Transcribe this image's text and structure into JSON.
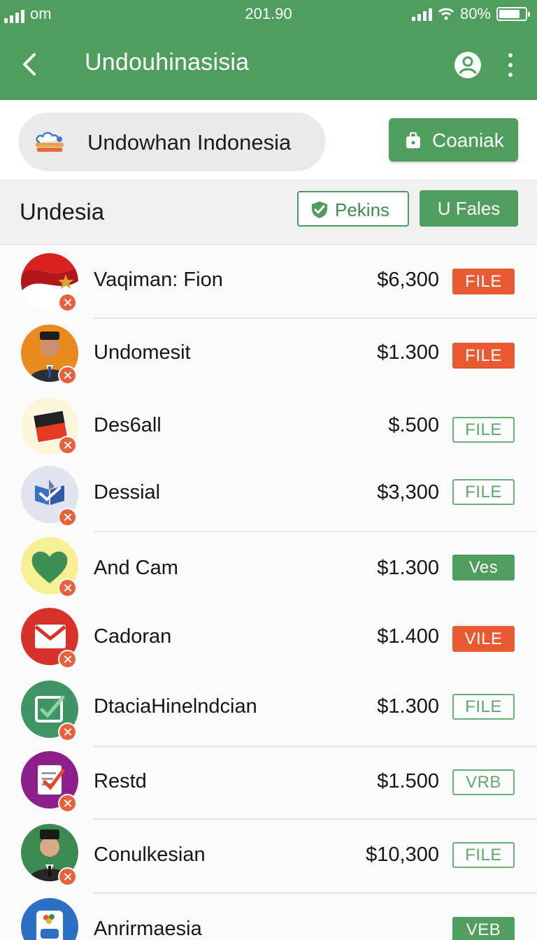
{
  "status": {
    "carrier": "om",
    "time": "201.90",
    "battery": "80%",
    "battery_level": 0.8
  },
  "appbar": {
    "title": "Undouhinasisia"
  },
  "search": {
    "label": "Undowhan Indonesia"
  },
  "action_button": {
    "label": "Coaniak"
  },
  "section": {
    "title": "Undesia"
  },
  "filters": {
    "outline_label": "Pekins",
    "solid_label": "U Fales"
  },
  "items": [
    {
      "name": "Vaqiman: Fion",
      "price": "$6,300",
      "tag": "FILE",
      "tag_style": "orange"
    },
    {
      "name": "Undomesit",
      "price": "$1.300",
      "tag": "FILE",
      "tag_style": "orange"
    },
    {
      "name": "Des6all",
      "price": "$.500",
      "tag": "FILE",
      "tag_style": "outline"
    },
    {
      "name": "Dessial",
      "price": "$3,300",
      "tag": "FILE",
      "tag_style": "outline"
    },
    {
      "name": "And Cam",
      "price": "$1.300",
      "tag": "Ves",
      "tag_style": "green"
    },
    {
      "name": "Cadoran",
      "price": "$1.400",
      "tag": "VILE",
      "tag_style": "orange"
    },
    {
      "name": "DtaciaHinelndcian",
      "price": "$1.300",
      "tag": "FILE",
      "tag_style": "outline"
    },
    {
      "name": "Restd",
      "price": "$1.500",
      "tag": "VRB",
      "tag_style": "outline"
    },
    {
      "name": "Conulkesian",
      "price": "$10,300",
      "tag": "FILE",
      "tag_style": "outline"
    },
    {
      "name": "Anrirmaesia",
      "price": "",
      "tag": "VEB",
      "tag_style": "green"
    }
  ],
  "colors": {
    "primary_green": "#4f9e5e",
    "accent_orange": "#ea5a32"
  }
}
